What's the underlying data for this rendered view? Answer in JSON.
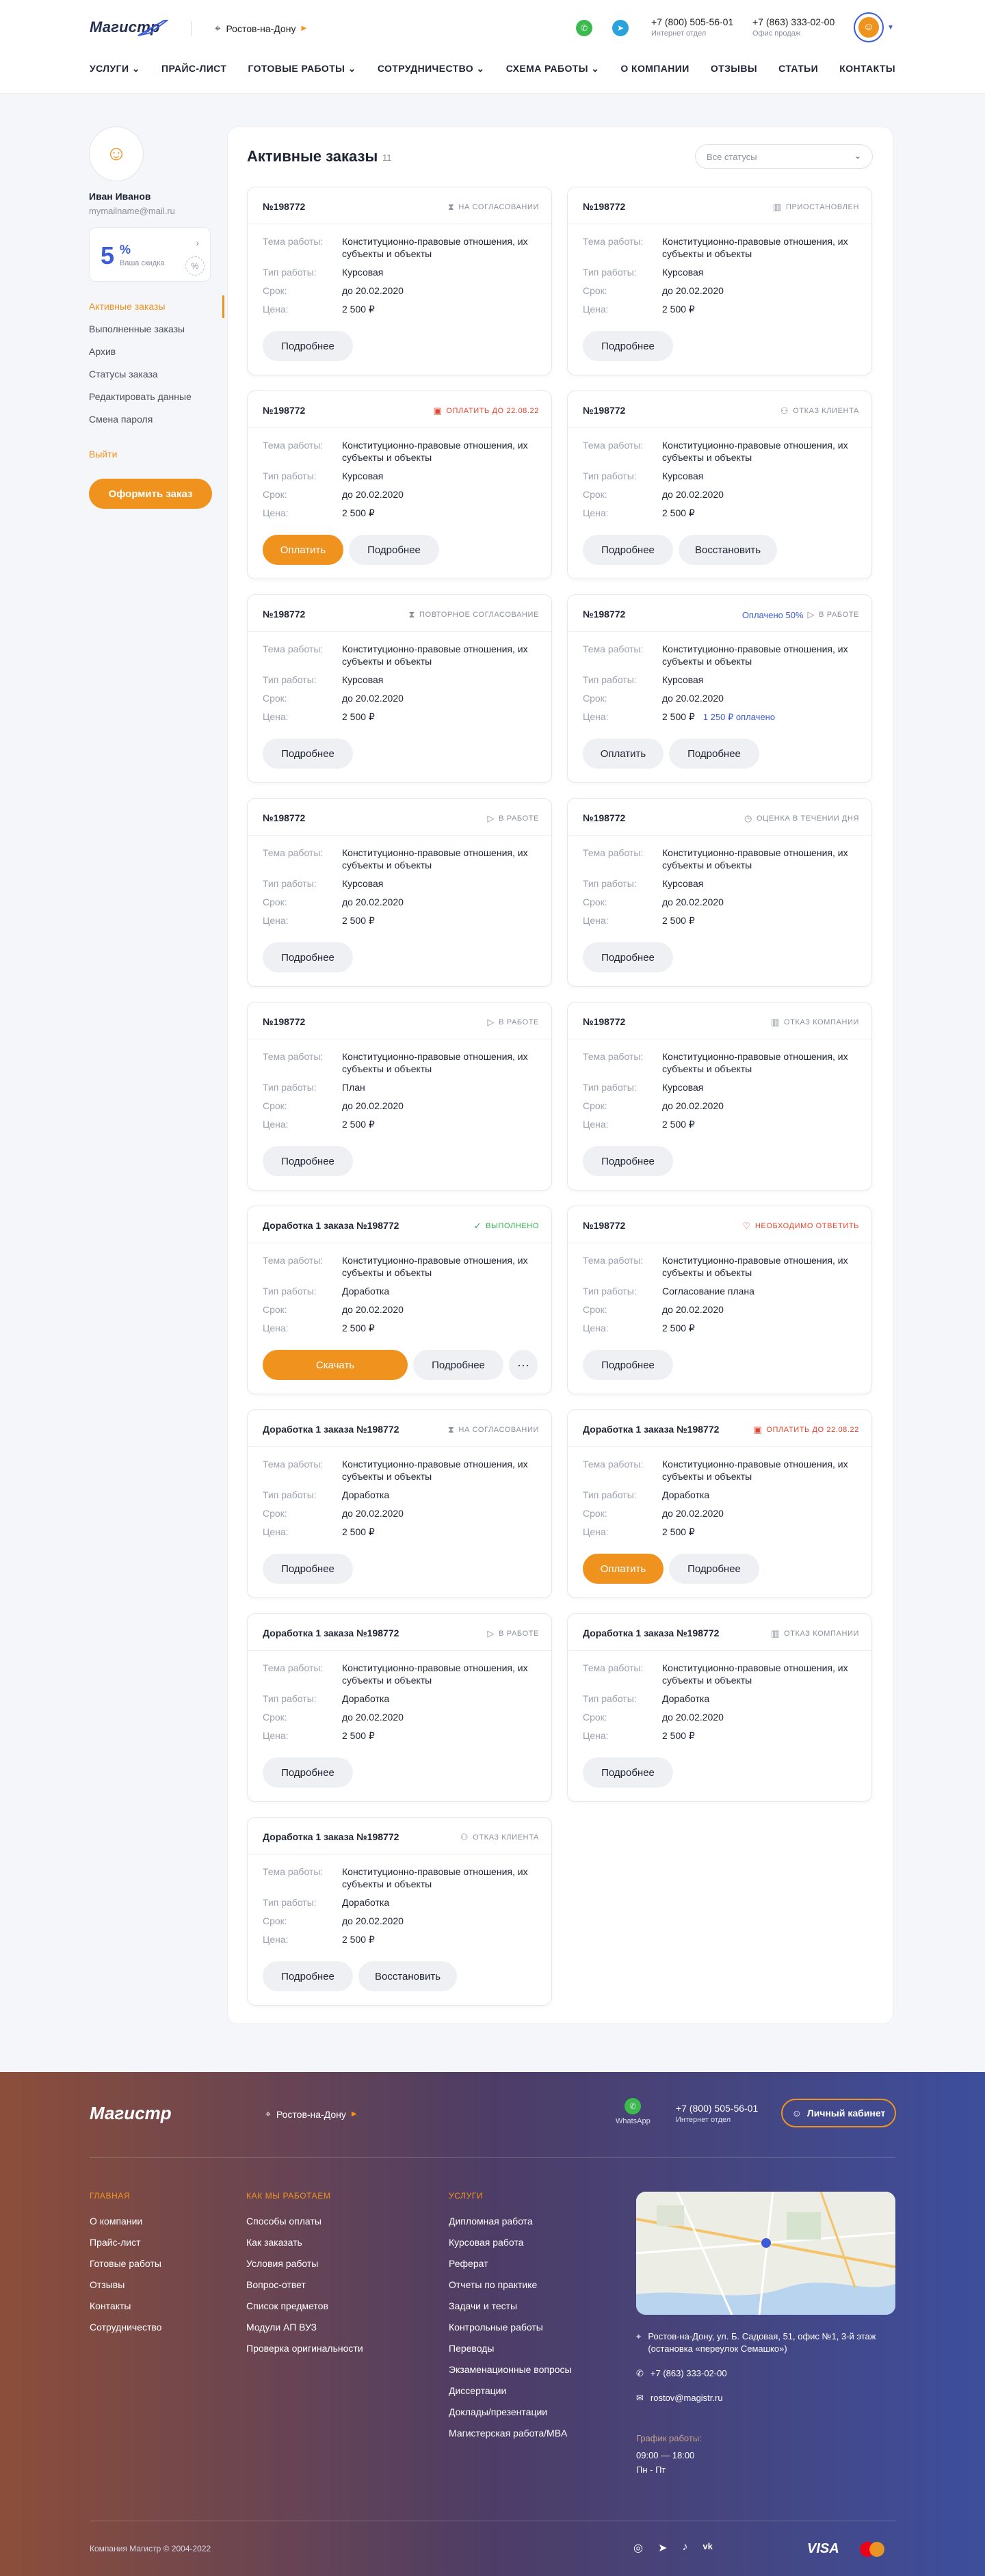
{
  "header": {
    "logo": "Магистр",
    "city": "Ростов-на-Дону",
    "phones": [
      {
        "number": "+7 (800) 505-56-01",
        "note": "Интернет отдел"
      },
      {
        "number": "+7 (863) 333-02-00",
        "note": "Офис продаж"
      }
    ],
    "nav": [
      "Услуги",
      "Прайс-лист",
      "Готовые работы",
      "Сотрудничество",
      "Схема работы",
      "О компании",
      "Отзывы",
      "Статьи",
      "Контакты"
    ]
  },
  "sidebar": {
    "name": "Иван Иванов",
    "email": "mymailname@mail.ru",
    "discount_value": "5",
    "discount_unit": "%",
    "discount_label": "Ваша скидка",
    "menu": [
      "Активные заказы",
      "Выполненные заказы",
      "Архив",
      "Статусы заказа",
      "Редактировать данные",
      "Смена пароля"
    ],
    "logout": "Выйти",
    "order_button": "Оформить заказ"
  },
  "main": {
    "title": "Активные заказы",
    "count": "11",
    "filter_placeholder": "Все статусы",
    "labels": {
      "topic": "Тема работы:",
      "type": "Тип работы:",
      "deadline": "Срок:",
      "price": "Цена:"
    },
    "orders": [
      {
        "id": "№198772",
        "status": "На согласовании",
        "topic": "Конституционно-правовые отношения, их субъекты и объекты",
        "type": "Курсовая",
        "deadline": "до 20.02.2020",
        "price": "2 500 ₽",
        "buttons": [
          "Подробнее"
        ]
      },
      {
        "id": "№198772",
        "status": "Приостановлен",
        "topic": "Конституционно-правовые отношения, их субъекты и объекты",
        "type": "Курсовая",
        "deadline": "до 20.02.2020",
        "price": "2 500 ₽",
        "buttons": [
          "Подробнее"
        ]
      },
      {
        "id": "№198772",
        "status": "Оплатить до 22.08.22",
        "status_color": "red",
        "topic": "Конституционно-правовые отношения, их субъекты и объекты",
        "type": "Курсовая",
        "deadline": "до 20.02.2020",
        "price": "2 500 ₽",
        "buttons": [
          "Оплатить",
          "Подробнее"
        ]
      },
      {
        "id": "№198772",
        "status": "Отказ клиента",
        "topic": "Конституционно-правовые отношения, их субъекты и объекты",
        "type": "Курсовая",
        "deadline": "до 20.02.2020",
        "price": "2 500 ₽",
        "buttons": [
          "Подробнее",
          "Восстановить"
        ]
      },
      {
        "id": "№198772",
        "status": "Повторное согласование",
        "topic": "Конституционно-правовые отношения, их субъекты и объекты",
        "type": "Курсовая",
        "deadline": "до 20.02.2020",
        "price": "2 500 ₽",
        "buttons": [
          "Подробнее"
        ]
      },
      {
        "id": "№198772",
        "status": "В работе",
        "paid_note": "Оплачено 50%",
        "topic": "Конституционно-правовые отношения, их субъекты и объекты",
        "type": "Курсовая",
        "deadline": "до 20.02.2020",
        "price": "2 500 ₽",
        "price_extra": "1 250 ₽ оплачено",
        "buttons": [
          "Оплатить",
          "Подробнее"
        ]
      },
      {
        "id": "№198772",
        "status": "В работе",
        "topic": "Конституционно-правовые отношения, их субъекты и объекты",
        "type": "Курсовая",
        "deadline": "до 20.02.2020",
        "price": "2 500 ₽",
        "buttons": [
          "Подробнее"
        ]
      },
      {
        "id": "№198772",
        "status": "Оценка в течении дня",
        "topic": "Конституционно-правовые отношения, их субъекты и объекты",
        "type": "Курсовая",
        "deadline": "до 20.02.2020",
        "price": "2 500 ₽",
        "buttons": [
          "Подробнее"
        ]
      },
      {
        "id": "№198772",
        "status": "В работе",
        "topic": "Конституционно-правовые отношения, их субъекты и объекты",
        "type": "План",
        "deadline": "до 20.02.2020",
        "price": "2 500 ₽",
        "buttons": [
          "Подробнее"
        ]
      },
      {
        "id": "№198772",
        "status": "Отказ компании",
        "topic": "Конституционно-правовые отношения, их субъекты и объекты",
        "type": "Курсовая",
        "deadline": "до 20.02.2020",
        "price": "2 500 ₽",
        "buttons": [
          "Подробнее"
        ]
      },
      {
        "id": "Доработка 1 заказа №198772",
        "status": "Выполнено",
        "status_color": "green",
        "topic": "Конституционно-правовые отношения, их субъекты и объекты",
        "type": "Доработка",
        "deadline": "до 20.02.2020",
        "price": "2 500 ₽",
        "buttons": [
          "Скачать",
          "Подробнее",
          "···"
        ]
      },
      {
        "id": "№198772",
        "status": "Необходимо ответить",
        "status_color": "red",
        "topic": "Конституционно-правовые отношения, их субъекты и объекты",
        "type": "Согласование плана",
        "deadline": "до 20.02.2020",
        "price": "2 500 ₽",
        "buttons": [
          "Подробнее"
        ]
      },
      {
        "id": "Доработка 1 заказа №198772",
        "status": "На согласовании",
        "topic": "Конституционно-правовые отношения, их субъекты и объекты",
        "type": "Доработка",
        "deadline": "до 20.02.2020",
        "price": "2 500 ₽",
        "buttons": [
          "Подробнее"
        ]
      },
      {
        "id": "Доработка 1 заказа №198772",
        "status": "Оплатить до 22.08.22",
        "status_color": "red",
        "topic": "Конституционно-правовые отношения, их субъекты и объекты",
        "type": "Доработка",
        "deadline": "до 20.02.2020",
        "price": "2 500 ₽",
        "buttons": [
          "Оплатить",
          "Подробнее"
        ]
      },
      {
        "id": "Доработка 1 заказа №198772",
        "status": "В работе",
        "topic": "Конституционно-правовые отношения, их субъекты и объекты",
        "type": "Доработка",
        "deadline": "до 20.02.2020",
        "price": "2 500 ₽",
        "buttons": [
          "Подробнее"
        ]
      },
      {
        "id": "Доработка 1 заказа №198772",
        "status": "Отказ компании",
        "topic": "Конституционно-правовые отношения, их субъекты и объекты",
        "type": "Доработка",
        "deadline": "до 20.02.2020",
        "price": "2 500 ₽",
        "buttons": [
          "Подробнее"
        ]
      },
      {
        "id": "Доработка 1 заказа №198772",
        "status": "Отказ клиента",
        "topic": "Конституционно-правовые отношения, их субъекты и объекты",
        "type": "Доработка",
        "deadline": "до 20.02.2020",
        "price": "2 500 ₽",
        "buttons": [
          "Подробнее",
          "Восстановить"
        ]
      }
    ]
  },
  "footer": {
    "logo": "Магистр",
    "city": "Ростов-на-Дону",
    "whatsapp": "WhatsApp",
    "phone": "+7 (800) 505-56-01",
    "phone_note": "Интернет отдел",
    "cabinet": "Личный кабинет",
    "col1": {
      "title": "Главная",
      "items": [
        "О компании",
        "Прайс-лист",
        "Готовые работы",
        "Отзывы",
        "Контакты",
        "Сотрудничество"
      ]
    },
    "col2": {
      "title": "Как мы работаем",
      "items": [
        "Способы оплаты",
        "Как заказать",
        "Условия работы",
        "Вопрос-ответ",
        "Список предметов",
        "Модули АП ВУЗ",
        "Проверка оригинальности"
      ]
    },
    "col3": {
      "title": "Услуги",
      "items": [
        "Дипломная работа",
        "Курсовая работа",
        "Реферат",
        "Отчеты по практике",
        "Задачи и тесты",
        "Контрольные работы",
        "Переводы",
        "Экзаменационные вопросы",
        "Диссертации",
        "Доклады/презентации",
        "Магистерская работа/MBA"
      ]
    },
    "address": "Ростов-на-Дону, ул. Б. Садовая, 51, офис №1, 3-й этаж (остановка «переулок Семашко»)",
    "office_phone": "+7 (863) 333-02-00",
    "email": "rostov@magistr.ru",
    "hours_title": "График работы:",
    "hours": "09:00 — 18:00",
    "days": "Пн - Пт",
    "copyright": "Компания Магистр © 2004-2022",
    "payment": "VISA"
  }
}
